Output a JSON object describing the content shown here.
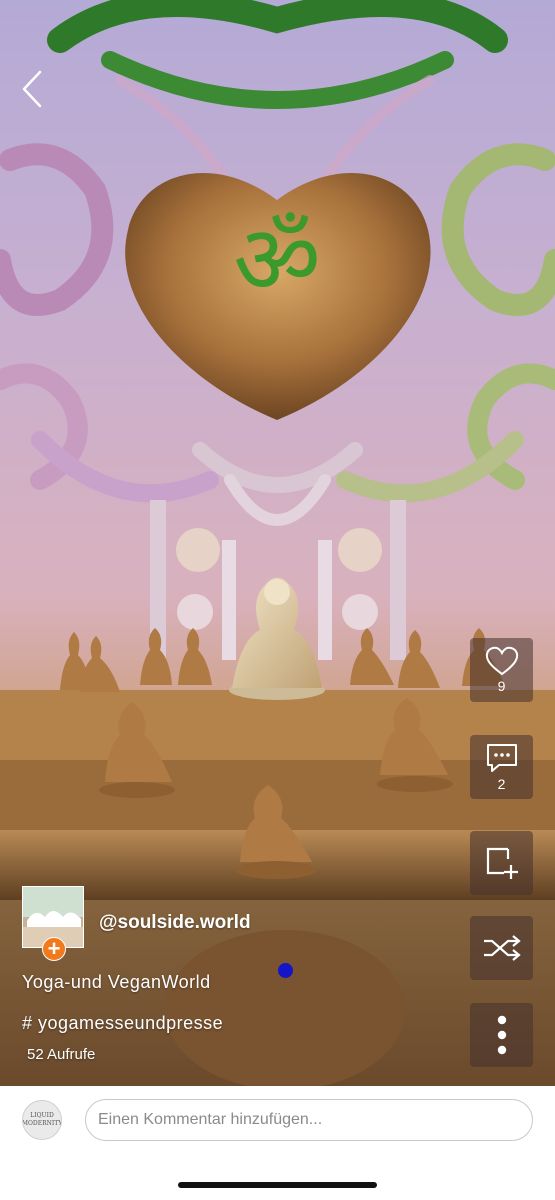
{
  "post": {
    "username": "@soulside.world",
    "title": "Yoga-und VeganWorld",
    "hashtag": "# yogamesseundpresse",
    "views": "52 Aufrufe"
  },
  "actions": {
    "likes": "9",
    "comments": "2"
  },
  "comment_bar": {
    "placeholder": "Einen Kommentar hinzufügen...",
    "avatar_text": "LIQUID MODERNITY"
  },
  "scene": {
    "symbol": "ॐ",
    "colors": {
      "sky_top": "#b4aad6",
      "sky_bottom": "#d9b1bd",
      "wood": "#a9733d",
      "om_green": "#3c9a2c",
      "follow_orange": "#f07a1c",
      "progress_blue": "#1515c8"
    }
  }
}
